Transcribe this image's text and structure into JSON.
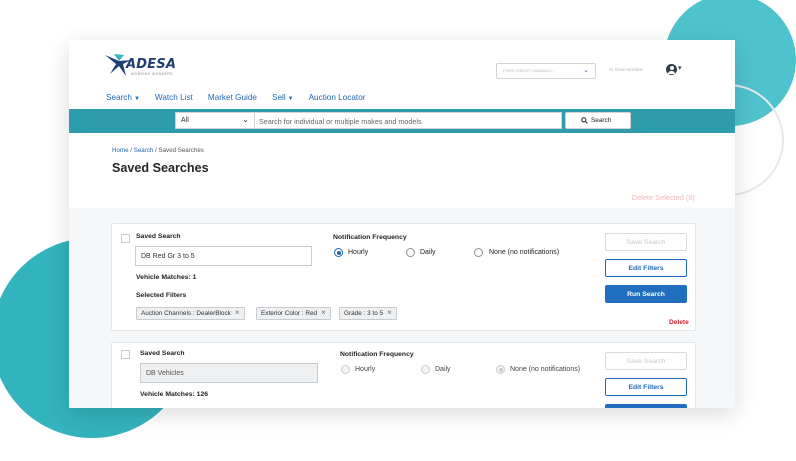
{
  "brand": {
    "name": "ADESA",
    "tagline": "WORKING WONDERS",
    "color": "#1f3f73"
  },
  "header": {
    "account_select": "FORD CREDIT CANADA C...",
    "user_greeting": "Hi, Dean Mcmillan",
    "user_icon": "user-circle-icon"
  },
  "nav": {
    "search": "Search",
    "watch_list": "Watch List",
    "market_guide": "Market Guide",
    "sell": "Sell",
    "auction_locator": "Auction Locator"
  },
  "searchbar": {
    "category": "All",
    "placeholder": "Search for individual or multiple makes and models",
    "button": "Search",
    "background": "#2f9cab"
  },
  "breadcrumb": {
    "home": "Home",
    "sep1": " / ",
    "search": "Search",
    "sep2": " / ",
    "current": "Saved Searches"
  },
  "page_title": "Saved Searches",
  "delete_selected": "Delete Selected (0)",
  "saved_searches": [
    {
      "saved_search_label": "Saved Search",
      "name": "DB Red Gr 3 to 5",
      "vehicle_matches": "Vehicle Matches: 1",
      "selected_filters_label": "Selected Filters",
      "filters": [
        "Auction Channels : DealerBlock",
        "Exterior Color : Red",
        "Grade : 3 to 5"
      ],
      "notification_label": "Notification Frequency",
      "frequency_options": [
        "Hourly",
        "Daily",
        "None (no notifications)"
      ],
      "selected_frequency": "Hourly",
      "save_button": "Save Search",
      "edit_button": "Edit Filters",
      "run_button": "Run Search",
      "delete_link": "Delete"
    },
    {
      "saved_search_label": "Saved Search",
      "name": "DB Vehicles",
      "vehicle_matches": "Vehicle Matches: 126",
      "notification_label": "Notification Frequency",
      "frequency_options": [
        "Hourly",
        "Daily",
        "None (no notifications)"
      ],
      "selected_frequency": "None (no notifications)",
      "save_button": "Save Search",
      "edit_button": "Edit Filters"
    }
  ],
  "colors": {
    "link": "#1f67b0",
    "primary_button": "#1f6fbe",
    "delete": "#d9202f",
    "accent_teal": "#4fc3cd"
  }
}
